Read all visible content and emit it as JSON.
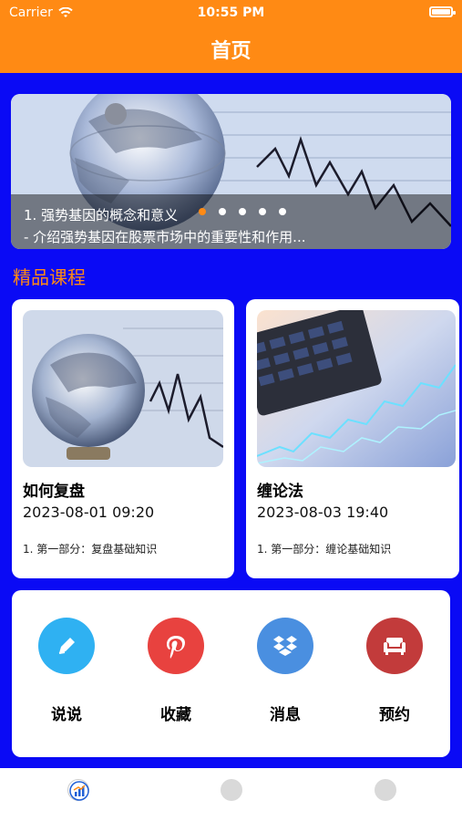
{
  "status": {
    "carrier": "Carrier",
    "time": "10:55 PM"
  },
  "header": {
    "title": "首页",
    "bg_color": "#ff8a14"
  },
  "banner": {
    "line1": "1. 强势基因的概念和意义",
    "line2": "- 介绍强势基因在股票市场中的重要性和作用...",
    "dot_count": 5,
    "active_dot": 0
  },
  "section": {
    "title": "精品课程"
  },
  "courses": [
    {
      "name": "如何复盘",
      "date": "2023-08-01 09:20",
      "desc": "1. 第一部分：复盘基础知识",
      "image": "globe-chart-image"
    },
    {
      "name": "缠论法",
      "date": "2023-08-03 19:40",
      "desc": "1. 第一部分：缠论基础知识",
      "image": "calculator-chart-image"
    }
  ],
  "shortcuts": [
    {
      "label": "说说",
      "icon": "pencil-icon",
      "color": "#2fb1f2"
    },
    {
      "label": "收藏",
      "icon": "pinterest-icon",
      "color": "#e8423f"
    },
    {
      "label": "消息",
      "icon": "dropbox-icon",
      "color": "#4a8fe0"
    },
    {
      "label": "预约",
      "icon": "sofa-icon",
      "color": "#c23b3b"
    }
  ],
  "tabbar": {
    "tabs": [
      {
        "name": "tab-home",
        "icon": "chart-icon",
        "active": true
      },
      {
        "name": "tab-second",
        "icon": "circle-icon",
        "active": false
      },
      {
        "name": "tab-third",
        "icon": "circle-icon",
        "active": false
      }
    ]
  }
}
